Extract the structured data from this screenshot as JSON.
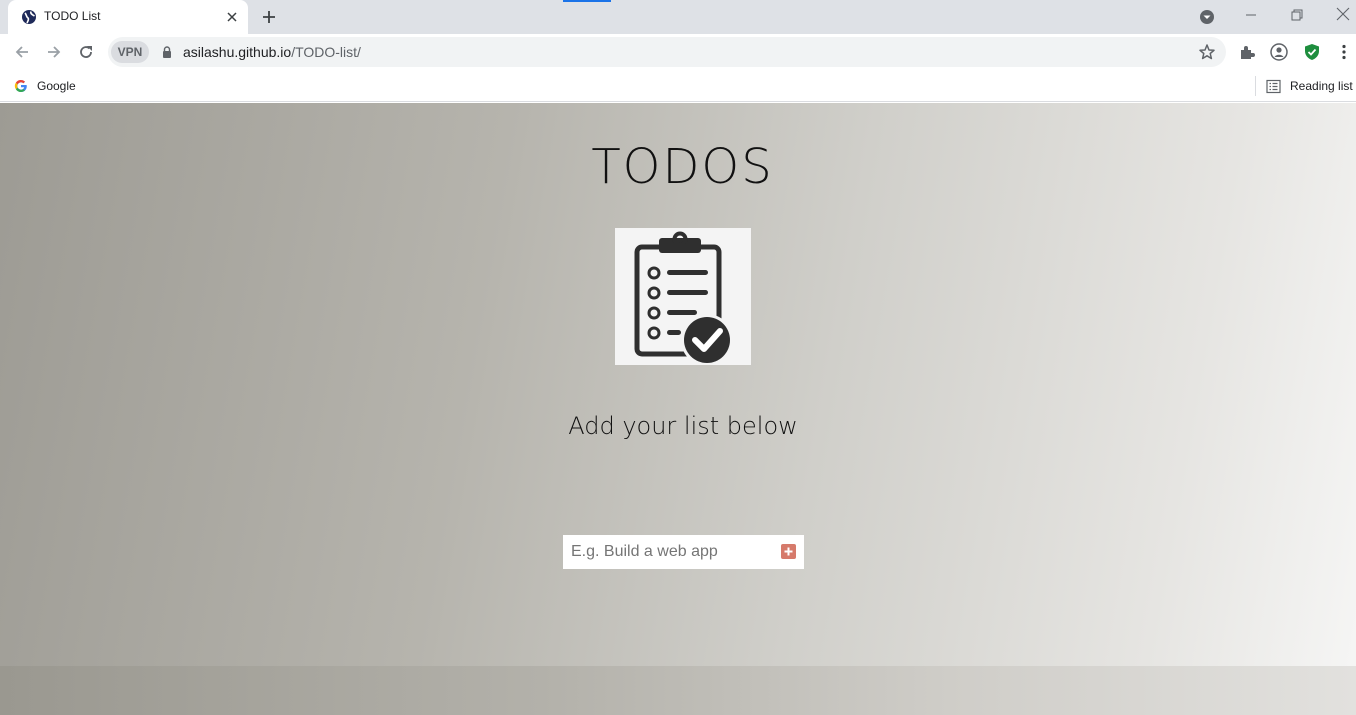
{
  "browser": {
    "tab": {
      "title": "TODO List",
      "active": true
    },
    "address": {
      "vpn_label": "VPN",
      "domain": "asilashu.github.io",
      "path": "/TODO-list/"
    },
    "bookmarks": [
      {
        "label": "Google"
      }
    ],
    "reading_list_label": "Reading list"
  },
  "app": {
    "title": "TODOS",
    "subtitle": "Add your list below",
    "input": {
      "placeholder": "E.g. Build a web app",
      "value": ""
    },
    "add_button_icon": "plus-square-icon"
  },
  "colors": {
    "tabstrip": "#dee1e6",
    "omnibox": "#f1f3f4",
    "add_button": "#d67a6b",
    "shield": "#1e8e3e",
    "background_left": "#9d9b94",
    "background_right": "#f6f6f5"
  },
  "icons": {
    "tab_favicon": "globe-icon",
    "back": "arrow-left-icon",
    "forward": "arrow-right-icon",
    "reload": "reload-icon",
    "lock": "lock-icon",
    "bookmark_star": "star-icon",
    "extensions": "puzzle-icon",
    "profile": "person-icon",
    "shield": "shield-check-icon",
    "menu": "more-vert-icon",
    "logo": "clipboard-checklist-icon"
  }
}
